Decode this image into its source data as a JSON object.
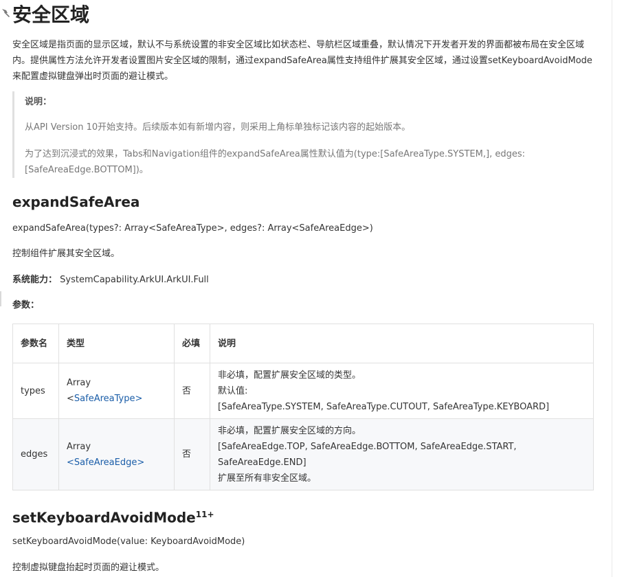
{
  "section": {
    "title": "安全区域",
    "intro": "安全区域是指页面的显示区域，默认不与系统设置的非安全区域比如状态栏、导航栏区域重叠，默认情况下开发者开发的界面都被布局在安全区域内。提供属性方法允许开发者设置图片安全区域的限制，通过expandSafeArea属性支持组件扩展其安全区域，通过设置setKeyboardAvoidMode来配置虚拟键盘弹出时页面的避让模式。"
  },
  "note": {
    "title": "说明：",
    "p1": "从API Version 10开始支持。后续版本如有新增内容，则采用上角标单独标记该内容的起始版本。",
    "p2": "为了达到沉浸式的效果，Tabs和Navigation组件的expandSafeArea属性默认值为(type:[SafeAreaType.SYSTEM,], edges:[SafeAreaEdge.BOTTOM])。"
  },
  "expand": {
    "heading": "expandSafeArea",
    "signature": "expandSafeArea(types?: Array<SafeAreaType>, edges?: Array<SafeAreaEdge>)",
    "description": "控制组件扩展其安全区域。",
    "capability_label": "系统能力：",
    "capability_value": "SystemCapability.ArkUI.ArkUI.Full",
    "params_label": "参数："
  },
  "table": {
    "headers": {
      "name": "参数名",
      "type": "类型",
      "required": "必填",
      "desc": "说明"
    },
    "rows": [
      {
        "name": "types",
        "type_prefix": "Array <",
        "type_link": "SafeAreaType",
        "type_suffix": ">",
        "required": "否",
        "desc_lines": [
          "非必填，配置扩展安全区域的类型。",
          "默认值:",
          "[SafeAreaType.SYSTEM, SafeAreaType.CUTOUT, SafeAreaType.KEYBOARD]"
        ]
      },
      {
        "name": "edges",
        "type_prefix": "Array",
        "type_prefix2": "<",
        "type_link": "SafeAreaEdge",
        "type_suffix": ">",
        "required": "否",
        "desc_lines": [
          "非必填，配置扩展安全区域的方向。",
          "[SafeAreaEdge.TOP, SafeAreaEdge.BOTTOM, SafeAreaEdge.START,",
          "SafeAreaEdge.END]",
          "扩展至所有非安全区域。"
        ]
      }
    ]
  },
  "keyboard": {
    "heading": "setKeyboardAvoidMode",
    "heading_sup": "11+",
    "signature": "setKeyboardAvoidMode(value: KeyboardAvoidMode)",
    "description": "控制虚拟键盘抬起时页面的避让模式。"
  }
}
